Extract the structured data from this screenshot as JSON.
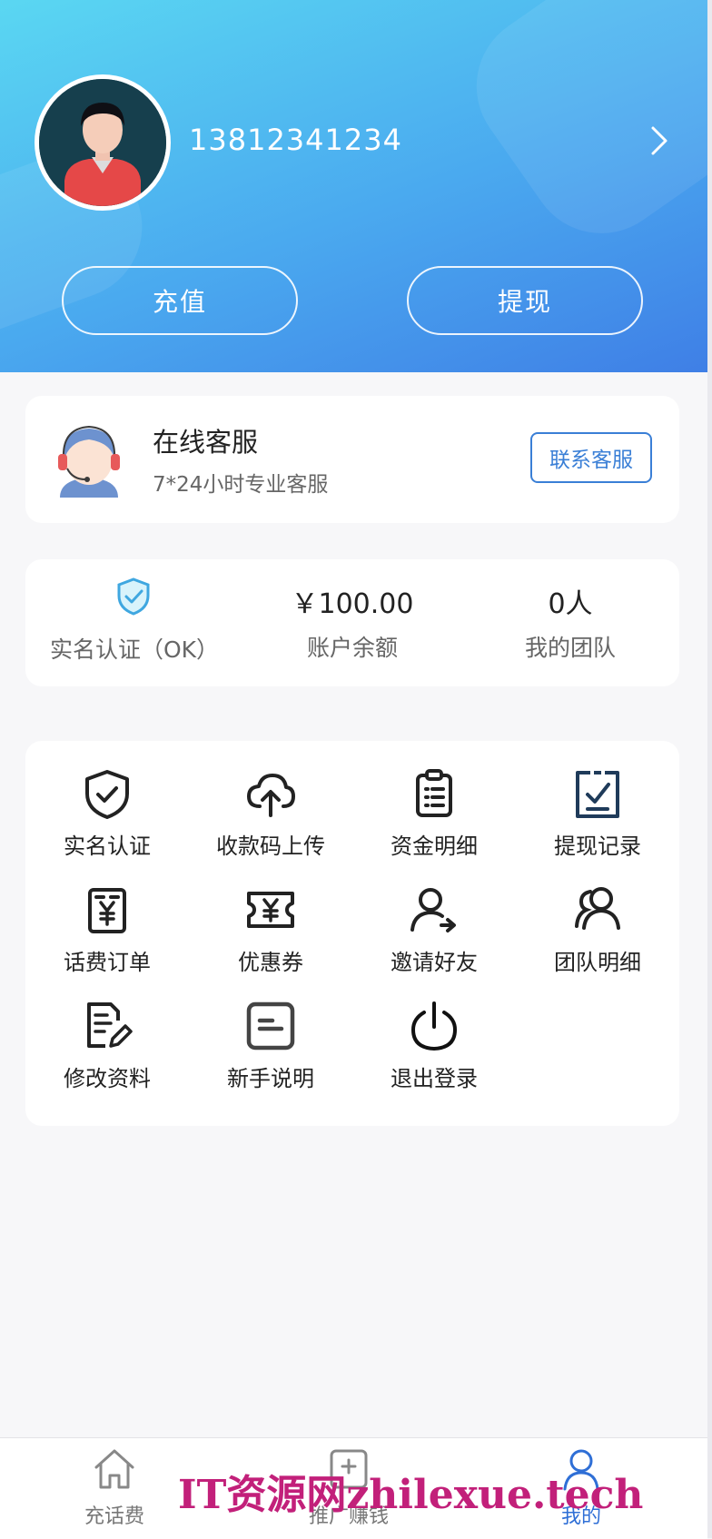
{
  "profile": {
    "phone": "13812341234"
  },
  "header": {
    "recharge_label": "充值",
    "withdraw_label": "提现"
  },
  "service": {
    "title": "在线客服",
    "subtitle": "7*24小时专业客服",
    "contact_label": "联系客服"
  },
  "stats": [
    {
      "value": "",
      "label": "实名认证（OK）"
    },
    {
      "value": "￥100.00",
      "label": "账户余额"
    },
    {
      "value": "0人",
      "label": "我的团队"
    }
  ],
  "menu": [
    {
      "label": "实名认证",
      "icon": "shield-check-icon"
    },
    {
      "label": "收款码上传",
      "icon": "cloud-upload-icon"
    },
    {
      "label": "资金明细",
      "icon": "clipboard-list-icon"
    },
    {
      "label": "提现记录",
      "icon": "clipboard-check-icon"
    },
    {
      "label": "话费订单",
      "icon": "yuan-receipt-icon"
    },
    {
      "label": "优惠券",
      "icon": "coupon-icon"
    },
    {
      "label": "邀请好友",
      "icon": "invite-user-icon"
    },
    {
      "label": "团队明细",
      "icon": "team-icon"
    },
    {
      "label": "修改资料",
      "icon": "edit-document-icon"
    },
    {
      "label": "新手说明",
      "icon": "guide-icon"
    },
    {
      "label": "退出登录",
      "icon": "power-icon"
    }
  ],
  "tabbar": [
    {
      "label": "充话费",
      "icon": "home-icon"
    },
    {
      "label": "推广赚钱",
      "icon": "promote-icon"
    },
    {
      "label": "我的",
      "icon": "user-icon"
    }
  ],
  "watermark": "IT资源网zhilexue.tech",
  "colors": {
    "accent": "#2f6fd6",
    "header_start": "#5ad7f2",
    "header_end": "#3f7fe6",
    "watermark": "#c2207a"
  }
}
